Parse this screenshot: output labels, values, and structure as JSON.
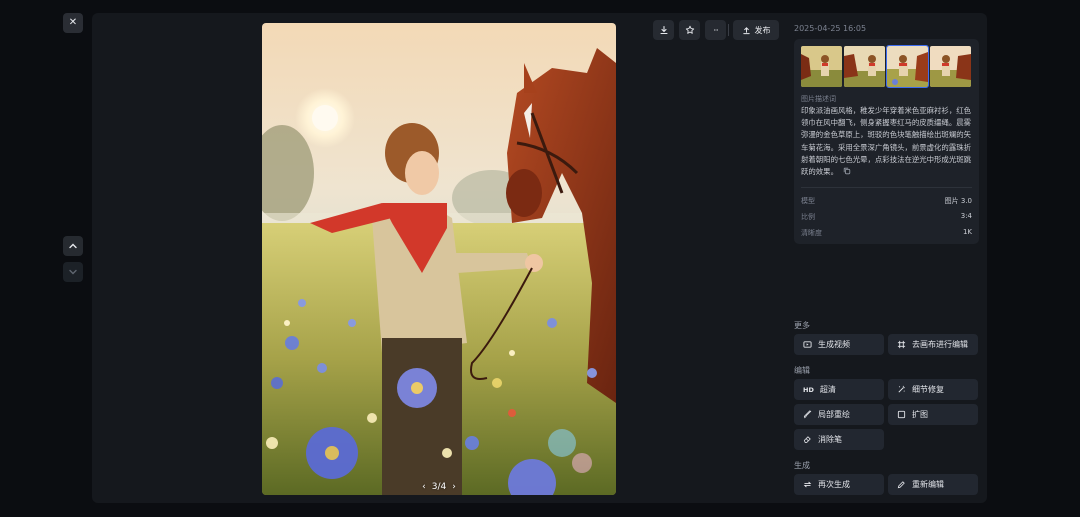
{
  "close_label": "✕",
  "toolbar": {
    "download_icon": "download-icon",
    "favorite_icon": "star-icon",
    "more_label": "···",
    "publish_label": "发布"
  },
  "pager": {
    "text": "3/4"
  },
  "sidebar": {
    "date": "2025-04-25 16:05",
    "description_label": "图片描述词",
    "description": "印象派油画风格，稚发少年穿着米色亚麻衬衫，红色领巾在风中翻飞，侧身紧握枣红马的皮质缰绳。晨雾弥漫的金色草原上，斑驳的色块笔触描绘出斑斓的矢车菊花海。采用全景深广角镜头，前景虚化的露珠折射着朝阳的七色光晕，点彩技法在逆光中形成光斑跳跃的效果。",
    "copy_icon": "copy-icon",
    "meta": [
      {
        "label": "模型",
        "value": "图片 3.0"
      },
      {
        "label": "比例",
        "value": "3:4"
      },
      {
        "label": "清晰度",
        "value": "1K"
      }
    ]
  },
  "sections": {
    "more": "更多",
    "edit": "编辑",
    "generate": "生成"
  },
  "actions": {
    "video": "生成视频",
    "canvas": "去画布进行编辑",
    "hd_tag": "HD",
    "upscale": "超清",
    "detail": "细节修复",
    "inpaint": "局部重绘",
    "expand": "扩图",
    "eraser": "消除笔",
    "regen": "再次生成",
    "reedit": "重新编辑"
  },
  "colors": {
    "accent": "#3d6cf0",
    "panel": "#15181d",
    "button": "#222730"
  }
}
